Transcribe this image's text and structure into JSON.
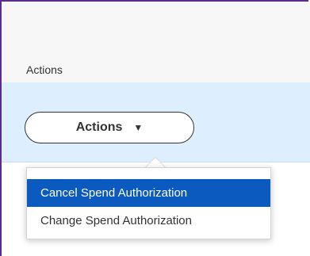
{
  "table": {
    "column_header": "Actions"
  },
  "actions_button": {
    "label": "Actions",
    "caret": "▼"
  },
  "dropdown": {
    "items": [
      {
        "label": "Cancel Spend Authorization",
        "highlighted": true
      },
      {
        "label": "Change Spend Authorization",
        "highlighted": false
      }
    ],
    "highlight_color": "#0a5abf"
  },
  "colors": {
    "frame_border": "#5b2c8a",
    "selected_row_bg": "#ddeeff",
    "header_bg": "#f7f7f7"
  }
}
